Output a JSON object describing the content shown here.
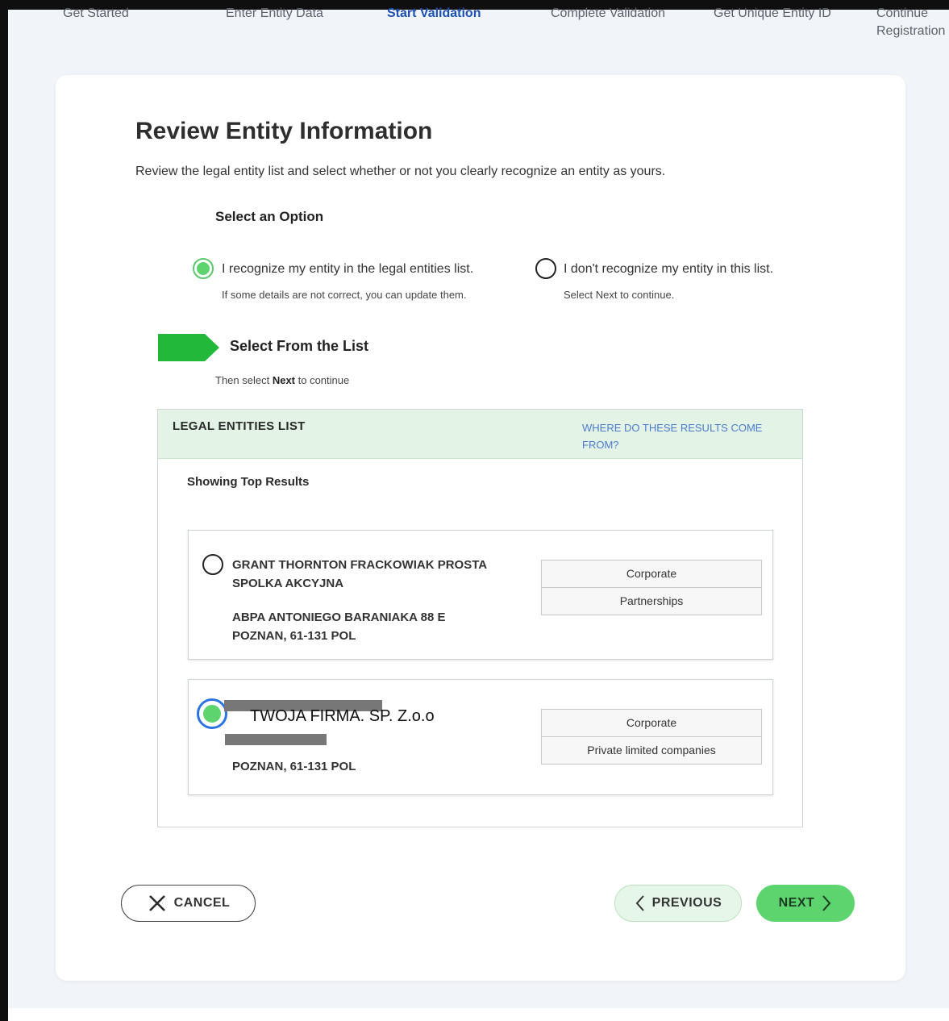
{
  "stepper": {
    "steps": [
      {
        "label": "Get Started",
        "line2": ""
      },
      {
        "label": "Enter Entity Data",
        "line2": ""
      },
      {
        "label": "Start Validation",
        "line2": ""
      },
      {
        "label": "Complete Validation",
        "line2": ""
      },
      {
        "label": "Get Unique Entity ID",
        "line2": ""
      },
      {
        "label": "Continue",
        "line2": "Registration"
      }
    ],
    "active_index": 2
  },
  "page": {
    "title": "Review Entity Information",
    "subtitle": "Review the legal entity list and select whether or not you clearly recognize an entity as yours."
  },
  "options": {
    "heading": "Select an Option",
    "recognize": {
      "label": "I recognize my entity in the legal entities list.",
      "sub": "If some details are not correct, you can update them.",
      "selected": true
    },
    "not_recognize": {
      "label": "I don't recognize my entity in this list.",
      "sub": "Select Next to continue.",
      "selected": false
    }
  },
  "list_section": {
    "heading": "Select From the List",
    "hint_prefix": "Then select ",
    "hint_bold": "Next",
    "hint_suffix": " to continue"
  },
  "entities": {
    "title": "LEGAL ENTITIES LIST",
    "where_link": "Where do these results come from?",
    "showing": "Showing Top Results",
    "items": [
      {
        "name": "GRANT THORNTON FRACKOWIAK PROSTA SPOLKA AKCYJNA",
        "address_line1": "ABPA ANTONIEGO BARANIAKA 88 E",
        "address_line2": "POZNAN, 61-131 POL",
        "tags": [
          "Corporate",
          "Partnerships"
        ],
        "selected": false
      },
      {
        "name": "TWOJA FIRMA. SP. Z.o.o",
        "address_line1": "",
        "address_line2": "POZNAN, 61-131 POL",
        "tags": [
          "Corporate",
          "Private limited companies"
        ],
        "selected": true
      }
    ]
  },
  "buttons": {
    "cancel": "CANCEL",
    "previous": "PREVIOUS",
    "next": "NEXT"
  },
  "colors": {
    "accent_green": "#5ed46f",
    "header_green": "#e3f3e5",
    "link_blue": "#4b7bd0",
    "active_step_blue": "#1a4fb3"
  }
}
